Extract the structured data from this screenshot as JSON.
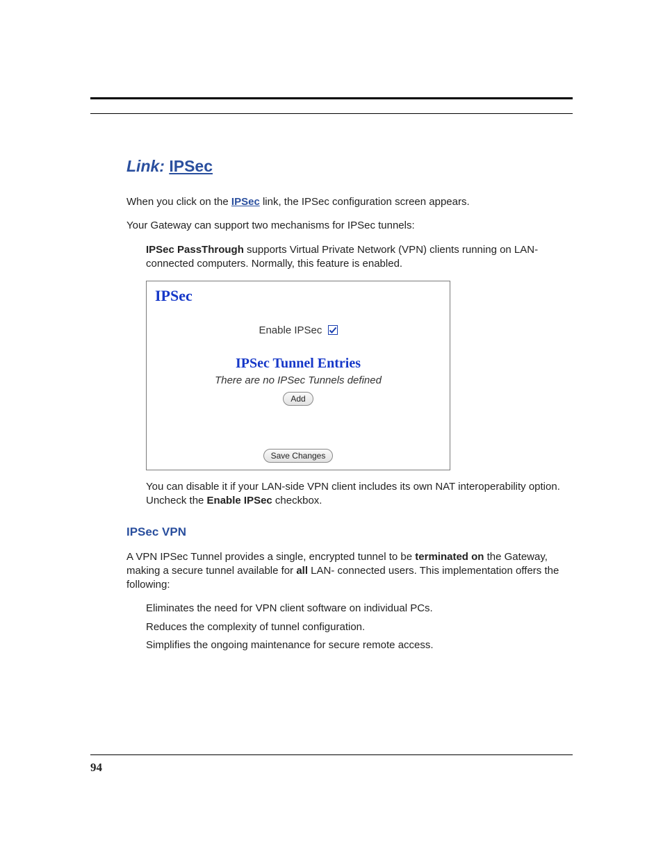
{
  "headline": {
    "prefix": "Link:",
    "title": "IPSec"
  },
  "intro": {
    "before_link": "When you click on the ",
    "link_text": "IPSec",
    "after_link": " link, the IPSec configuration screen appears."
  },
  "support_sentence": "Your Gateway can support two mechanisms for IPSec tunnels:",
  "passthrough": {
    "bold": "IPSec PassThrough",
    "rest": " supports Virtual Private Network (VPN) clients running on LAN-connected computers. Normally, this feature is enabled."
  },
  "panel": {
    "header": "IPSec",
    "enable_label": "Enable IPSec",
    "enable_checked": true,
    "tunnel_title": "IPSec Tunnel Entries",
    "tunnel_empty_msg": "There are no IPSec Tunnels defined",
    "add_button": "Add",
    "save_button": "Save Changes"
  },
  "disable_note": {
    "before_bold": "You can disable it if your LAN-side VPN client includes its own NAT interoperability option. Uncheck the ",
    "bold": "Enable IPSec",
    "after_bold": " checkbox."
  },
  "ipsec_vpn": {
    "heading": "IPSec VPN",
    "para_before_b1": "A VPN IPSec Tunnel provides a single, encrypted tunnel to be ",
    "bold1": "terminated on",
    "para_mid": " the Gateway, making a secure tunnel available for ",
    "bold2": "all",
    "para_after": " LAN- connected users. This implementation offers the following:",
    "benefits": [
      "Eliminates the need for VPN client software on individual PCs.",
      "Reduces the complexity of tunnel configuration.",
      "Simplifies the ongoing maintenance for secure remote access."
    ]
  },
  "page_number": "94"
}
